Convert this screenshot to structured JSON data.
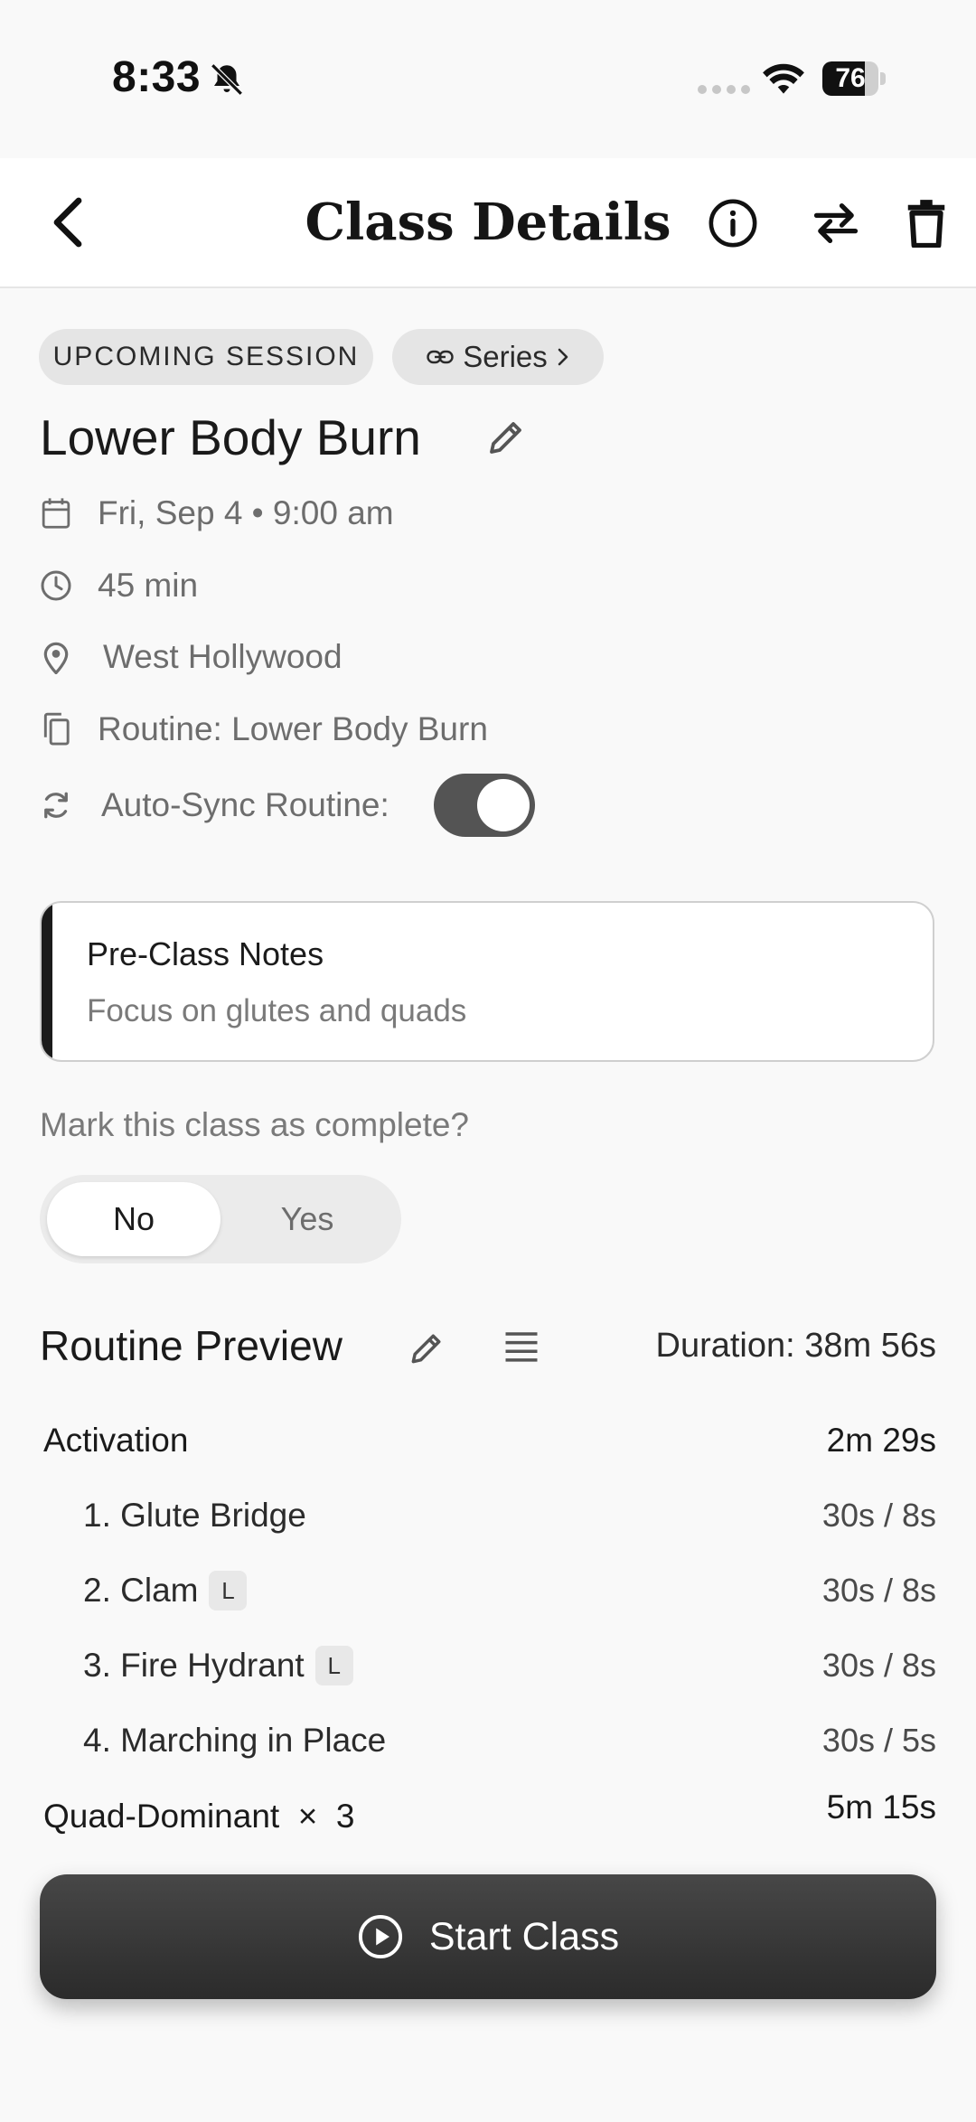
{
  "status_bar": {
    "time": "8:33",
    "battery": "76",
    "battery_level": 0.76
  },
  "header": {
    "title": "Class Details",
    "icons": [
      "back-chevron-icon",
      "info-icon",
      "swap-arrows-icon",
      "trash-icon"
    ]
  },
  "chips": {
    "session": "UPCOMING SESSION",
    "series": "Series"
  },
  "class": {
    "title": "Lower Body Burn",
    "datetime": "Fri, Sep 4 • 9:00 am",
    "duration": "45 min",
    "location": "West Hollywood",
    "routine": "Routine: Lower Body Burn",
    "auto_sync_label": "Auto-Sync Routine:",
    "auto_sync_on": true
  },
  "notes": {
    "title": "Pre-Class Notes",
    "text": "Focus on glutes and quads"
  },
  "complete": {
    "question": "Mark this class as complete?",
    "no": "No",
    "yes": "Yes",
    "selected": "No"
  },
  "routine_preview": {
    "title": "Routine Preview",
    "duration": "Duration: 38m 56s",
    "sections": [
      {
        "name": "Activation",
        "time": "2m 29s",
        "exercises": [
          {
            "name": "1. Glute Bridge",
            "badge": "",
            "time": "30s / 8s"
          },
          {
            "name": "2. Clam",
            "badge": "L",
            "time": "30s / 8s"
          },
          {
            "name": "3. Fire Hydrant",
            "badge": "L",
            "time": "30s / 8s"
          },
          {
            "name": "4. Marching in Place",
            "badge": "",
            "time": "30s / 5s"
          }
        ]
      },
      {
        "name": "Quad-Dominant  ×  3",
        "time": "5m 15s",
        "exercises": []
      }
    ]
  },
  "start_button": {
    "label": "Start Class"
  },
  "colors": {
    "accent_dark": "#2b2b2b",
    "toggle_on": "#545454",
    "background": "#f9f9f9"
  }
}
